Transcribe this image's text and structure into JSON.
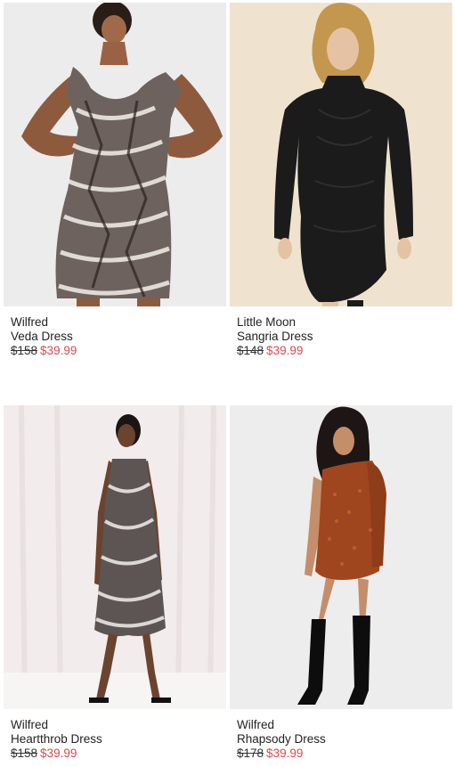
{
  "products": [
    {
      "brand": "Wilfred",
      "name": "Veda Dress",
      "original_price": "$158",
      "sale_price": "$39.99",
      "image_icon": "model-photo-animal-print-dress"
    },
    {
      "brand": "Little Moon",
      "name": "Sangria Dress",
      "original_price": "$148",
      "sale_price": "$39.99",
      "image_icon": "model-photo-black-dress"
    },
    {
      "brand": "Wilfred",
      "name": "Heartthrob Dress",
      "original_price": "$158",
      "sale_price": "$39.99",
      "image_icon": "model-photo-print-slip-dress"
    },
    {
      "brand": "Wilfred",
      "name": "Rhapsody Dress",
      "original_price": "$178",
      "sale_price": "$39.99",
      "image_icon": "model-photo-rust-one-shoulder-dress"
    }
  ],
  "colors": {
    "sale": "#e0474c",
    "text": "#222222"
  }
}
